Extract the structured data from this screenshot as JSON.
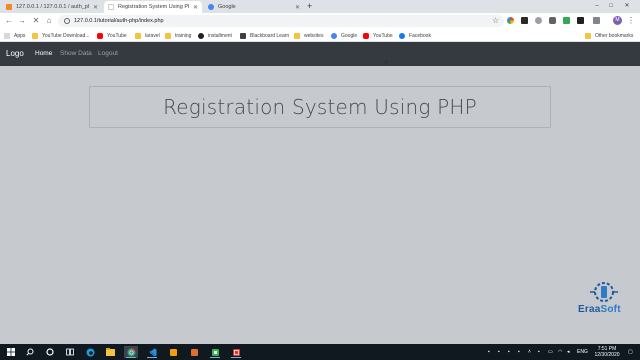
{
  "browser": {
    "tabs": [
      {
        "title": "127.0.0.1 / 127.0.0.1 / auth_php",
        "favicon_color": "#f08a24",
        "active": false
      },
      {
        "title": "Registration System Using PHP",
        "favicon_color": "#ffffff",
        "active": true
      },
      {
        "title": "Google",
        "favicon_color": "#4285f4",
        "active": false
      }
    ],
    "new_tab_label": "+",
    "window_controls": {
      "minimize": "–",
      "maximize": "□",
      "close": "✕"
    },
    "address": {
      "url": "127.0.0.1/tutorial/auth-php/index.php"
    },
    "bookmarks": [
      {
        "label": "Apps",
        "icon_color": "#5f6368"
      },
      {
        "label": "YouTube Download...",
        "icon_color": "#f5c242"
      },
      {
        "label": "YouTube",
        "icon_color": "#ff0000"
      },
      {
        "label": "laravel",
        "icon_color": "#f5c242"
      },
      {
        "label": "training",
        "icon_color": "#f5c242"
      },
      {
        "label": "installment",
        "icon_color": "#202124"
      },
      {
        "label": "Blackboard Learn",
        "icon_color": "#3c4043"
      },
      {
        "label": "websites",
        "icon_color": "#f5c242"
      },
      {
        "label": "Google",
        "icon_color": "#4285f4"
      },
      {
        "label": "YouTube",
        "icon_color": "#ff0000"
      },
      {
        "label": "Facebook",
        "icon_color": "#1877f2"
      }
    ],
    "other_bookmarks": "Other bookmarks",
    "profile_initial": "M"
  },
  "site": {
    "brand": "Logo",
    "nav": [
      {
        "label": "Home",
        "active": true
      },
      {
        "label": "Show Data",
        "active": false
      },
      {
        "label": "Logout",
        "active": false
      }
    ],
    "heading": "Registration System Using PHP"
  },
  "watermark": {
    "part1": "Eraa",
    "part2": "Soft"
  },
  "taskbar": {
    "lang": "ENG",
    "time": "7:51 PM",
    "date": "12/30/2020"
  }
}
